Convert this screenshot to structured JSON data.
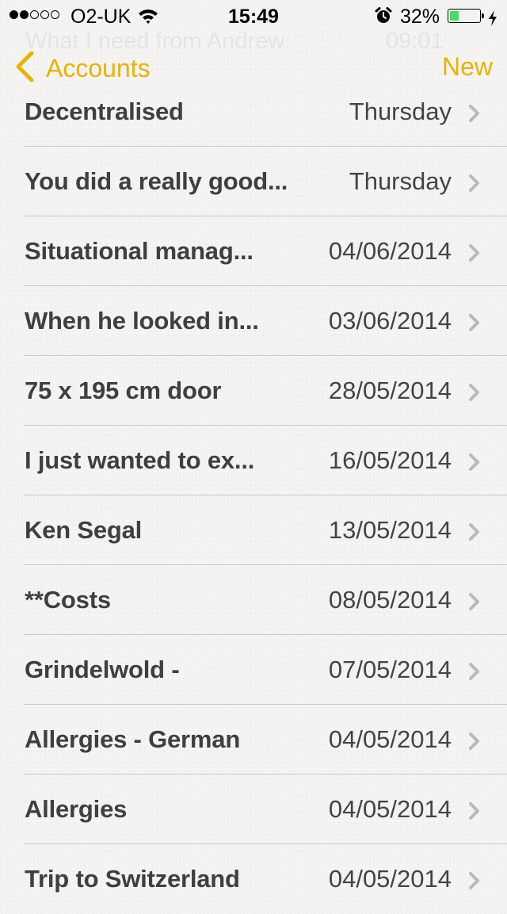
{
  "status_bar": {
    "signal_bars_filled": 2,
    "signal_bars_total": 5,
    "carrier": "O2-UK",
    "wifi_icon": "wifi-icon",
    "time": "15:49",
    "alarm_icon": "alarm-clock-icon",
    "battery_percent_label": "32%",
    "battery_level": 0.32,
    "charging_icon": "lightning-bolt-icon",
    "battery_color": "#4cd964"
  },
  "ghost_row": {
    "title": "What I need from Andrew:",
    "date": "09:01"
  },
  "nav": {
    "back_label": "Accounts",
    "back_icon": "chevron-left-icon",
    "new_label": "New",
    "accent_color": "#e6b20b"
  },
  "notes": [
    {
      "title": "Decentralised",
      "date": "Thursday"
    },
    {
      "title": "You did a really good...",
      "date": "Thursday"
    },
    {
      "title": "Situational manag...",
      "date": "04/06/2014"
    },
    {
      "title": "When he looked in...",
      "date": "03/06/2014"
    },
    {
      "title": "75 x 195 cm door",
      "date": "28/05/2014"
    },
    {
      "title": "I just wanted to ex...",
      "date": "16/05/2014"
    },
    {
      "title": "Ken Segal",
      "date": "13/05/2014"
    },
    {
      "title": "**Costs",
      "date": "08/05/2014"
    },
    {
      "title": "Grindelwold -",
      "date": "07/05/2014"
    },
    {
      "title": "Allergies - German",
      "date": "04/05/2014"
    },
    {
      "title": "Allergies",
      "date": "04/05/2014"
    },
    {
      "title": "Trip to Switzerland",
      "date": "04/05/2014"
    }
  ]
}
